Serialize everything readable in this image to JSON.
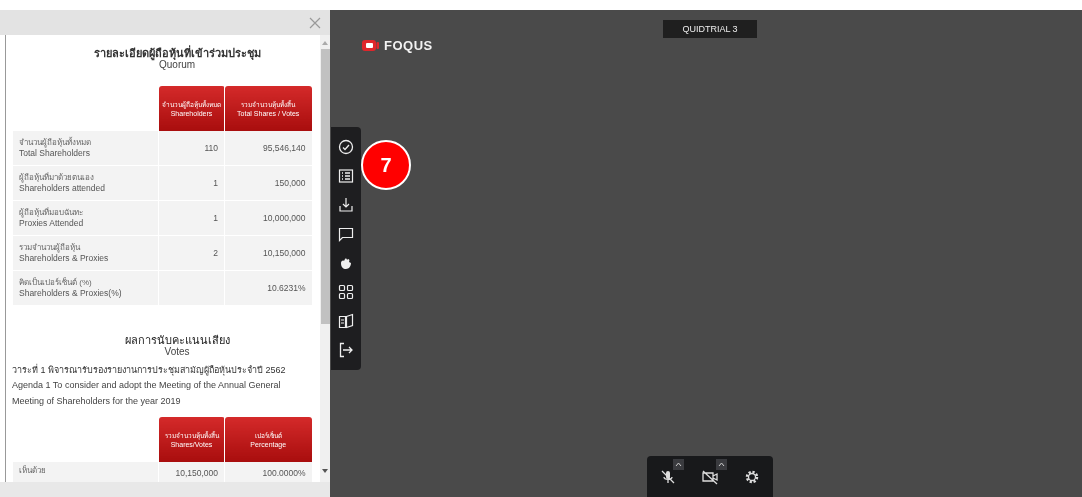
{
  "panel": {
    "quorum": {
      "title_th": "รายละเอียดผู้ถือหุ้นที่เข้าร่วมประชุม",
      "title_en": "Quorum",
      "columns": [
        {
          "th": "จำนวนผู้ถือหุ้นทั้งหมด",
          "en": "Shareholders"
        },
        {
          "th": "รวมจำนวนหุ้นทั้งสิ้น",
          "en": "Total Shares / Votes"
        }
      ],
      "rows": [
        {
          "th": "จำนวนผู้ถือหุ้นทั้งหมด",
          "en": "Total Shareholders",
          "shareholders": "110",
          "shares": "95,546,140"
        },
        {
          "th": "ผู้ถือหุ้นที่มาด้วยตนเอง",
          "en": "Shareholders attended",
          "shareholders": "1",
          "shares": "150,000"
        },
        {
          "th": "ผู้ถือหุ้นที่มอบฉันทะ",
          "en": "Proxies Attended",
          "shareholders": "1",
          "shares": "10,000,000"
        },
        {
          "th": "รวมจำนวนผู้ถือหุ้น",
          "en": "Shareholders & Proxies",
          "shareholders": "2",
          "shares": "10,150,000"
        },
        {
          "th": "คิดเป็นเปอร์เซ็นต์ (%)",
          "en": "Shareholders & Proxies(%)",
          "shareholders": "",
          "shares": "10.6231%"
        }
      ]
    },
    "votes": {
      "title_th": "ผลการนับคะแนนเสียง",
      "title_en": "Votes",
      "agenda_th": "วาระที่ 1 พิจารณารับรองรายงานการประชุมสามัญผู้ถือหุ้นประจำปี 2562",
      "agenda_en": "Agenda 1 To consider and adopt the Meeting of the Annual General Meeting of Shareholders for the year 2019",
      "columns": [
        {
          "th": "รวมจำนวนหุ้นทั้งสิ้น",
          "en": "Shares/Votes"
        },
        {
          "th": "เปอร์เซ็นต์",
          "en": "Percentage"
        }
      ],
      "rows": [
        {
          "th": "เห็นด้วย",
          "shares": "10,150,000",
          "percentage": "100.0000%"
        }
      ]
    }
  },
  "logo": "FOQUS",
  "meeting_name": "QUIDTRIAL 3",
  "badge": "7"
}
